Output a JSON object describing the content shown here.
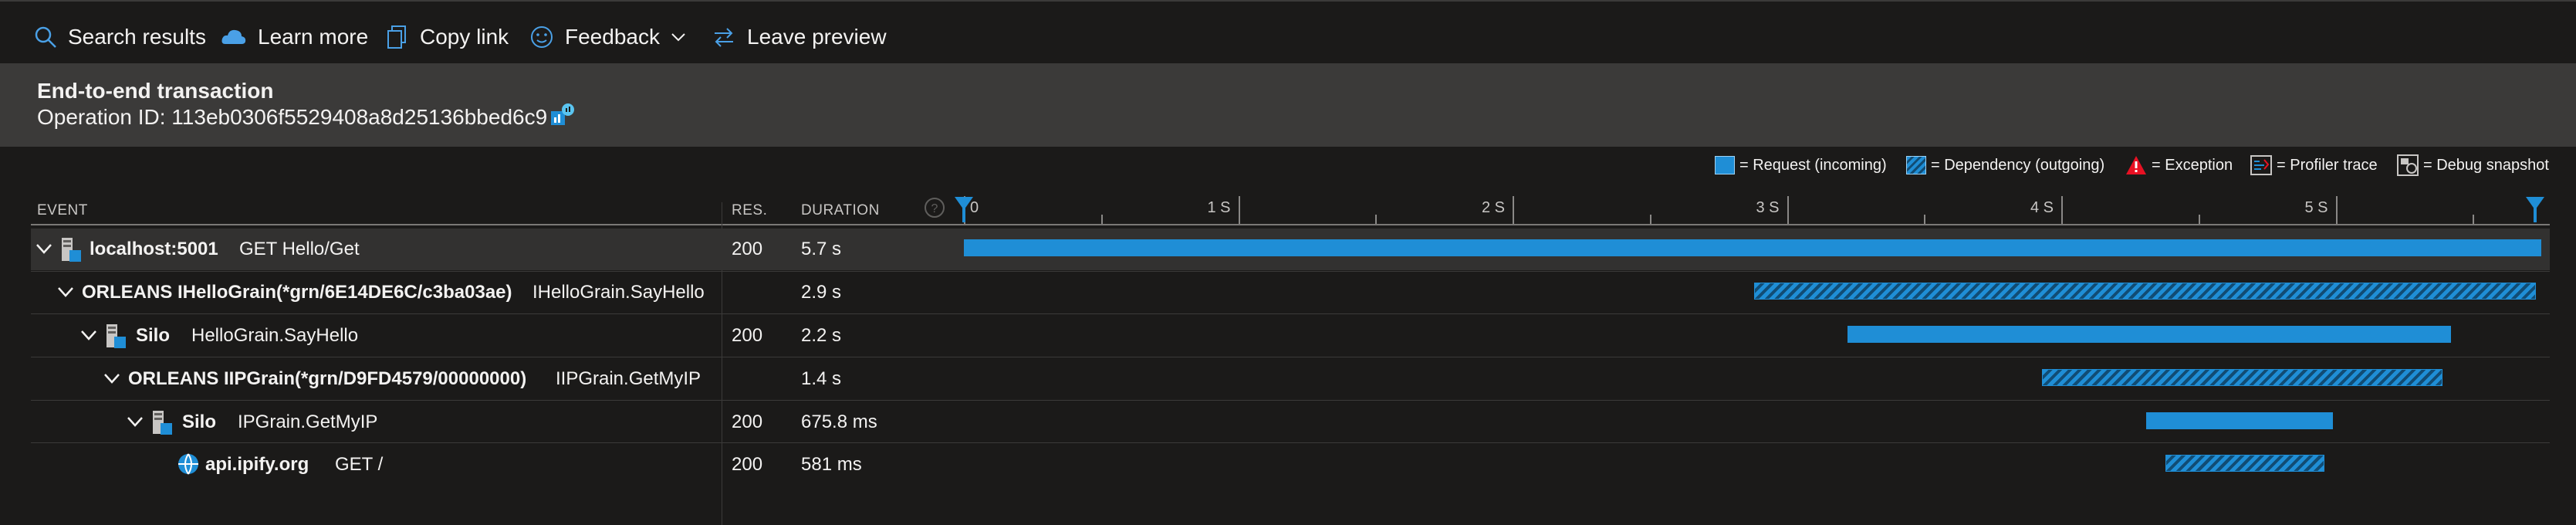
{
  "toolbar": {
    "search": "Search results",
    "learn": "Learn more",
    "copy": "Copy link",
    "feedback": "Feedback",
    "leave": "Leave preview"
  },
  "header": {
    "title": "End-to-end transaction",
    "operation": "Operation ID: 113eb0306f5529408a8d25136bbed6c9"
  },
  "legend": {
    "request": "= Request (incoming)",
    "dependency": "= Dependency (outgoing)",
    "exception": "= Exception",
    "profiler": "= Profiler trace",
    "debug": "= Debug snapshot"
  },
  "columns": {
    "event": "EVENT",
    "res": "RES.",
    "duration": "DURATION"
  },
  "timeline": {
    "ticks": [
      "0",
      "1 S",
      "2 S",
      "3 S",
      "4 S",
      "5 S"
    ],
    "max_seconds": 5.75
  },
  "rows": [
    {
      "name": "localhost:5001",
      "op": "GET Hello/Get",
      "res": "200",
      "duration": "5.7 s",
      "kind": "request",
      "start_s": 0.0,
      "end_s": 5.75
    },
    {
      "name": "ORLEANS IHelloGrain(*grn/6E14DE6C/c3ba03ae)",
      "op": "IHelloGrain.SayHello",
      "res": "",
      "duration": "2.9 s",
      "kind": "dependency",
      "start_s": 2.88,
      "end_s": 5.73
    },
    {
      "name": "Silo",
      "op": "HelloGrain.SayHello",
      "res": "200",
      "duration": "2.2 s",
      "kind": "request",
      "start_s": 3.22,
      "end_s": 5.42
    },
    {
      "name": "ORLEANS IIPGrain(*grn/D9FD4579/00000000)",
      "op": "IIPGrain.GetMyIP",
      "res": "",
      "duration": "1.4 s",
      "kind": "dependency",
      "start_s": 3.93,
      "end_s": 5.39
    },
    {
      "name": "Silo",
      "op": "IPGrain.GetMyIP",
      "res": "200",
      "duration": "675.8 ms",
      "kind": "request",
      "start_s": 4.31,
      "end_s": 4.99
    },
    {
      "name": "api.ipify.org",
      "op": "GET /",
      "res": "200",
      "duration": "581 ms",
      "kind": "dependency",
      "start_s": 4.38,
      "end_s": 4.96
    }
  ]
}
